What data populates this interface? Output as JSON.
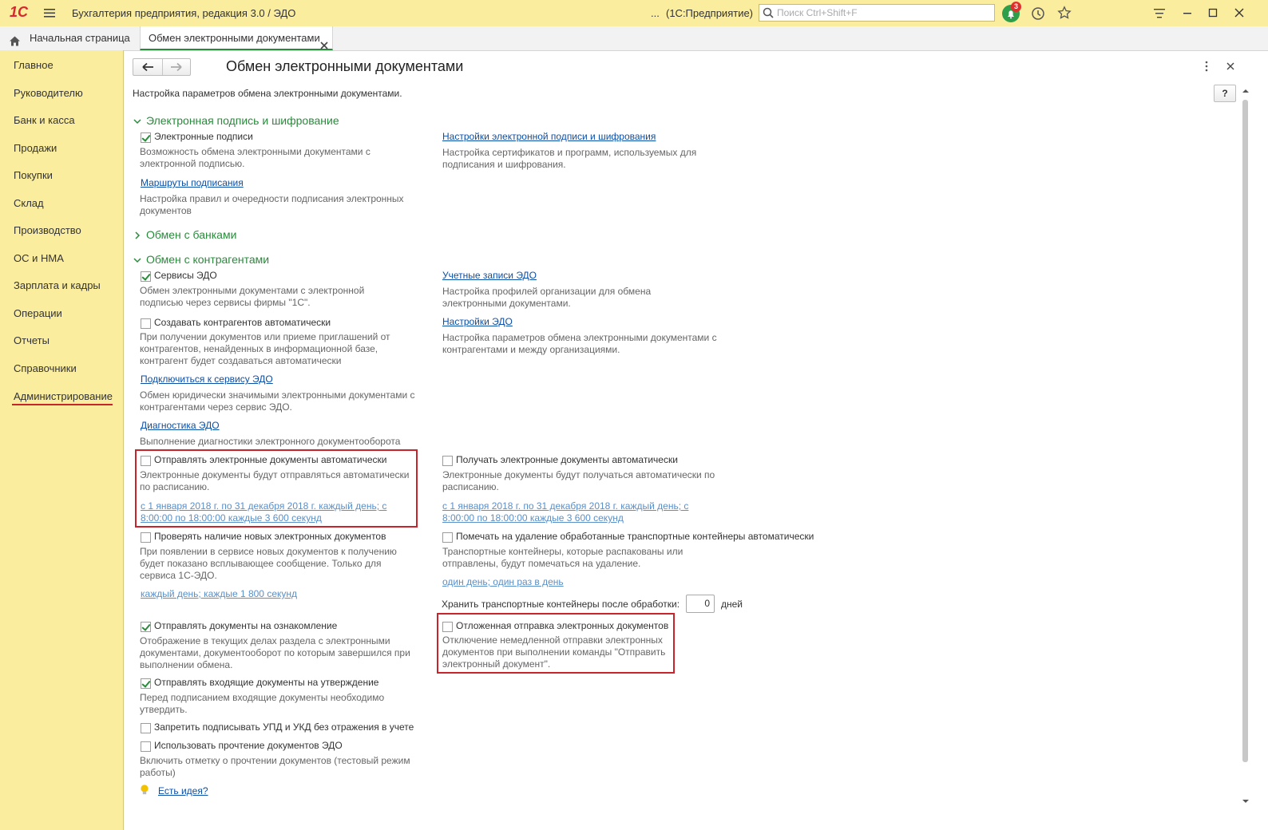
{
  "app": {
    "logo": "1С",
    "title": "Бухгалтерия предприятия, редакция 3.0 / ЭДО",
    "ellipsis": "...",
    "platform": "(1С:Предприятие)",
    "search_placeholder": "Поиск Ctrl+Shift+F",
    "notification_count": "3"
  },
  "tabs": [
    {
      "label": "Начальная страница"
    },
    {
      "label": "Обмен электронными документами"
    }
  ],
  "sidebar": {
    "items": [
      {
        "label": "Главное"
      },
      {
        "label": "Руководителю"
      },
      {
        "label": "Банк и касса"
      },
      {
        "label": "Продажи"
      },
      {
        "label": "Покупки"
      },
      {
        "label": "Склад"
      },
      {
        "label": "Производство"
      },
      {
        "label": "ОС и НМА"
      },
      {
        "label": "Зарплата и кадры"
      },
      {
        "label": "Операции"
      },
      {
        "label": "Отчеты"
      },
      {
        "label": "Справочники"
      },
      {
        "label": "Администрирование"
      }
    ]
  },
  "main": {
    "title": "Обмен электронными документами",
    "subtitle": "Настройка параметров обмена электронными документами.",
    "help_label": "?",
    "sec1": {
      "title": "Электронная подпись и шифрование",
      "esig_label": "Электронные подписи",
      "esig_desc": "Возможность обмена электронными документами с электронной подписью.",
      "esig_settings_link": "Настройки электронной подписи и шифрования",
      "esig_settings_desc": "Настройка сертификатов и программ, используемых для подписания и шифрования.",
      "routes_link": "Маршруты подписания",
      "routes_desc": "Настройка правил и очередности подписания электронных документов"
    },
    "sec2": {
      "title": "Обмен с банками"
    },
    "sec3": {
      "title": "Обмен с контрагентами",
      "services_label": "Сервисы ЭДО",
      "services_desc": "Обмен электронными документами с электронной подписью через сервисы фирмы \"1С\".",
      "accounts_link": "Учетные записи ЭДО",
      "accounts_desc": "Настройка профилей организации для обмена электронными документами.",
      "create_label": "Создавать контрагентов автоматически",
      "create_desc": "При получении документов или приеме приглашений от контрагентов, ненайденных в информационной базе, контрагент будет создаваться автоматически",
      "edo_settings_link": "Настройки ЭДО",
      "edo_settings_desc": "Настройка параметров обмена электронными документами с контрагентами и между организациями.",
      "connect_link": "Подключиться к сервису ЭДО",
      "connect_desc": "Обмен юридически значимыми электронными документами с контрагентами через сервис ЭДО.",
      "diag_link": "Диагностика ЭДО",
      "diag_desc": "Выполнение диагностики электронного документооборота",
      "send_auto_label": "Отправлять электронные документы автоматически",
      "send_auto_desc": "Электронные документы будут отправляться автоматически по расписанию.",
      "send_auto_schedule": "с 1 января 2018 г. по 31 декабря 2018 г. каждый день; с 8:00:00 по 18:00:00 каждые 3 600 секунд",
      "recv_auto_label": "Получать электронные документы автоматически",
      "recv_auto_desc": "Электронные документы будут получаться автоматически по расписанию.",
      "recv_auto_schedule": "с 1 января 2018 г. по 31 декабря 2018 г. каждый день; с 8:00:00 по 18:00:00 каждые 3 600 секунд",
      "check_new_label": "Проверять наличие новых электронных документов",
      "check_new_desc": "При появлении в сервисе новых документов к получению будет показано всплывающее сообщение. Только для сервиса 1С-ЭДО.",
      "check_new_schedule": "каждый день; каждые 1 800 секунд",
      "mark_delete_label": "Помечать на удаление обработанные транспортные контейнеры автоматически",
      "mark_delete_desc": "Транспортные контейнеры, которые распакованы или отправлены, будут помечаться на удаление.",
      "mark_delete_schedule": "один день; один раз в день",
      "keep_label": "Хранить транспортные контейнеры после обработки:",
      "keep_value": "0",
      "keep_unit": "дней",
      "deferred_label": "Отложенная отправка электронных документов",
      "deferred_desc": "Отключение немедленной отправки электронных документов при выполнении команды \"Отправить электронный документ\".",
      "review_label": "Отправлять документы на ознакомление",
      "review_desc": "Отображение в текущих делах раздела с электронными документами, документооборот по которым завершился при выполнении обмена.",
      "approve_label": "Отправлять входящие документы на утверждение",
      "approve_desc": "Перед подписанием входящие документы необходимо утвердить.",
      "forbid_label": "Запретить подписывать УПД и УКД без отражения в учете",
      "read_label": "Использовать прочтение документов ЭДО",
      "read_desc": "Включить отметку о прочтении документов (тестовый режим работы)",
      "idea_link": "Есть идея?"
    }
  },
  "colors": {
    "accent_green": "#2a8a3c",
    "panel_yellow": "#fbed9e",
    "link_blue": "#0b4fa8",
    "highlight_red": "#c8242c"
  }
}
